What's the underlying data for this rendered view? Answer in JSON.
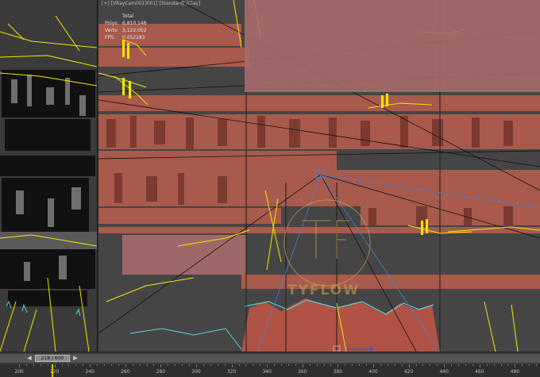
{
  "viewport": {
    "label": "[+] [VRayCam001]001] [Standard] [Clay]",
    "stats": {
      "header": "Total",
      "rows": [
        {
          "key": "Polys:",
          "value": "6,810,146"
        },
        {
          "key": "Verts:",
          "value": "3,122,052"
        },
        {
          "key": "FPS:",
          "value": "0.052283"
        }
      ]
    },
    "watermark": "TYFLOW"
  },
  "timeline": {
    "slider_label": "218 / 600",
    "prev_icon": "chevron-left-icon",
    "next_icon": "chevron-right-icon",
    "ticks": [
      "200",
      "220",
      "240",
      "260",
      "280",
      "300",
      "320",
      "340",
      "360",
      "380",
      "400",
      "420",
      "440",
      "460",
      "480"
    ],
    "current_frame": 218
  },
  "colors": {
    "viewport_border": "#c8b400",
    "geometry": "#a85a4c",
    "splines": "#f2e600",
    "overlay": "#a86b6b"
  }
}
